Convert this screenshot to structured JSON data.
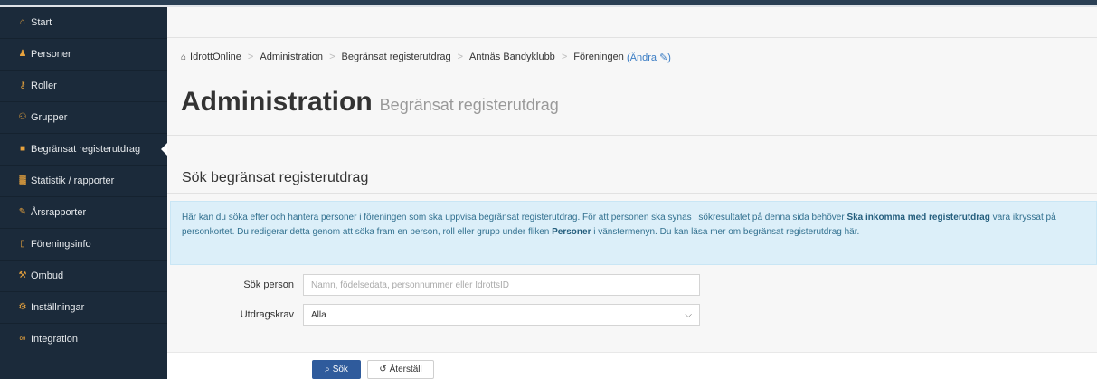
{
  "sidebar": {
    "items": [
      {
        "label": "Start",
        "icon": "home-icon",
        "glyph": "⌂",
        "color": "#e8a33d"
      },
      {
        "label": "Personer",
        "icon": "user-icon",
        "glyph": "♟",
        "color": "#e8a33d"
      },
      {
        "label": "Roller",
        "icon": "key-icon",
        "glyph": "⚷",
        "color": "#e8a33d"
      },
      {
        "label": "Grupper",
        "icon": "group-icon",
        "glyph": "⚇",
        "color": "#e8a33d"
      },
      {
        "label": "Begränsat registerutdrag",
        "icon": "clipboard-icon",
        "glyph": "■",
        "color": "#e8a33d",
        "active": true
      },
      {
        "label": "Statistik / rapporter",
        "icon": "bar-chart-icon",
        "glyph": "▓",
        "color": "#e8a33d"
      },
      {
        "label": "Årsrapporter",
        "icon": "pencil-icon",
        "glyph": "✎",
        "color": "#e8a33d"
      },
      {
        "label": "Föreningsinfo",
        "icon": "document-icon",
        "glyph": "▯",
        "color": "#e8a33d"
      },
      {
        "label": "Ombud",
        "icon": "gavel-icon",
        "glyph": "⚒",
        "color": "#e8a33d"
      },
      {
        "label": "Inställningar",
        "icon": "gear-icon",
        "glyph": "⚙",
        "color": "#e8a33d"
      },
      {
        "label": "Integration",
        "icon": "link-icon",
        "glyph": "∞",
        "color": "#e8a33d"
      }
    ]
  },
  "breadcrumb": {
    "items": [
      "IdrottOnline",
      "Administration",
      "Begränsat registerutdrag",
      "Antnäs Bandyklubb",
      "Föreningen"
    ],
    "change_label": "Ändra"
  },
  "page": {
    "title": "Administration",
    "subtitle": "Begränsat registerutdrag"
  },
  "section": {
    "title": "Sök begränsat registerutdrag"
  },
  "info": {
    "part1": "Här kan du söka efter och hantera personer i föreningen som ska uppvisa begränsat registerutdrag. För att personen ska synas i sökresultatet på denna sida behöver ",
    "bold1": "Ska inkomma med registerutdrag",
    "part2": " vara ikryssat på personkortet. Du redigerar detta genom att söka fram en person, roll eller grupp under fliken ",
    "bold2": "Personer",
    "part3": " i vänstermenyn. Du kan läsa mer om begränsat registerutdrag här."
  },
  "form": {
    "search_label": "Sök person",
    "search_placeholder": "Namn, födelsedata, personnummer eller IdrottsID",
    "requirement_label": "Utdragskrav",
    "requirement_value": "Alla"
  },
  "buttons": {
    "search_label": "Sök",
    "reset_label": "Återställ"
  },
  "colors": {
    "sidebar_bg": "#1b2a3a",
    "accent": "#2f5b9c",
    "info_bg": "#dceff9"
  }
}
